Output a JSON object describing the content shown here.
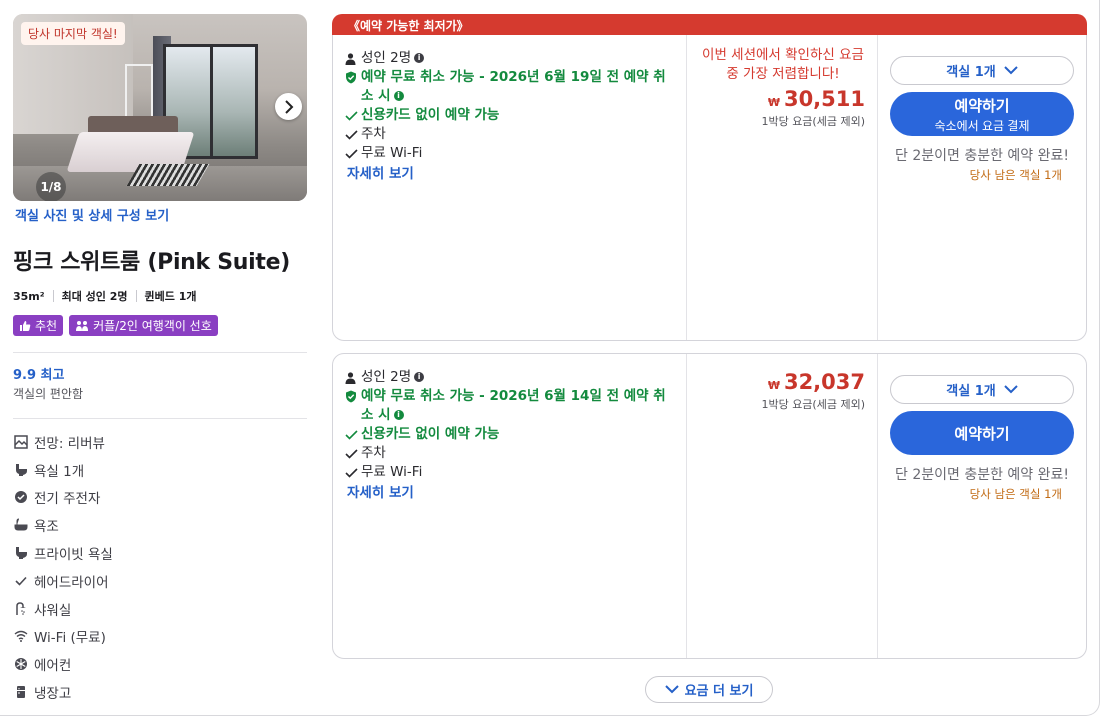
{
  "photo": {
    "badge": "당사 마지막 객실!",
    "counter": "1/8",
    "link": "객실 사진 및 상세 구성 보기"
  },
  "room": {
    "title": "핑크 스위트룸 (Pink Suite)",
    "size": "35m²",
    "max_guests": "최대 성인 2명",
    "bed": "퀸베드 1개",
    "tags": [
      "추천",
      "커플/2인 여행객이 선호"
    ],
    "score": "9.9 최고",
    "score_label": "객실의 편안함",
    "amenities": [
      {
        "icon": "view-icon",
        "label": "전망: 리버뷰"
      },
      {
        "icon": "toilet-icon",
        "label": "욕실 1개"
      },
      {
        "icon": "kettle-icon",
        "label": "전기 주전자"
      },
      {
        "icon": "bathtub-icon",
        "label": "욕조"
      },
      {
        "icon": "toilet-icon",
        "label": "프라이빗 욕실"
      },
      {
        "icon": "check-icon",
        "label": "헤어드라이어"
      },
      {
        "icon": "shower-icon",
        "label": "샤워실"
      },
      {
        "icon": "wifi-icon",
        "label": "Wi-Fi (무료)"
      },
      {
        "icon": "aircon-icon",
        "label": "에어컨"
      },
      {
        "icon": "fridge-icon",
        "label": "냉장고"
      }
    ]
  },
  "banner": "《예약 가능한 최저가》",
  "offers": [
    {
      "guests": "성인 2명",
      "cancel": "예약 무료 취소 가능 - 2026년 6월 19일 전 예약 취소 시",
      "no_card": "신용카드 없이 예약 가능",
      "parking": "주차",
      "wifi": "무료 Wi-Fi",
      "details": "자세히 보기",
      "promo": "이번 세션에서 확인하신 요금 중 가장 저렴합니다!",
      "currency": "₩",
      "price": "30,511",
      "price_note": "1박당 요금(세금 제외)",
      "room_select": "객실 1개",
      "book": "예약하기",
      "book_sub": "숙소에서 요금 결제",
      "quick": "단 2분이면 충분한 예약 완료!",
      "rooms_left": "당사 남은 객실 1개"
    },
    {
      "guests": "성인 2명",
      "cancel": "예약 무료 취소 가능 - 2026년 6월 14일 전 예약 취소 시",
      "no_card": "신용카드 없이 예약 가능",
      "parking": "주차",
      "wifi": "무료 Wi-Fi",
      "details": "자세히 보기",
      "currency": "₩",
      "price": "32,037",
      "price_note": "1박당 요금(세금 제외)",
      "room_select": "객실 1개",
      "book": "예약하기",
      "quick": "단 2분이면 충분한 예약 완료!",
      "rooms_left": "당사 남은 객실 1개"
    }
  ],
  "more_rates": "요금 더 보기",
  "colors": {
    "accent": "#2a66db",
    "banner": "#d53a2f",
    "price": "#c8362b",
    "free_cancel": "#138a3e",
    "tag": "#8a3fc2"
  }
}
